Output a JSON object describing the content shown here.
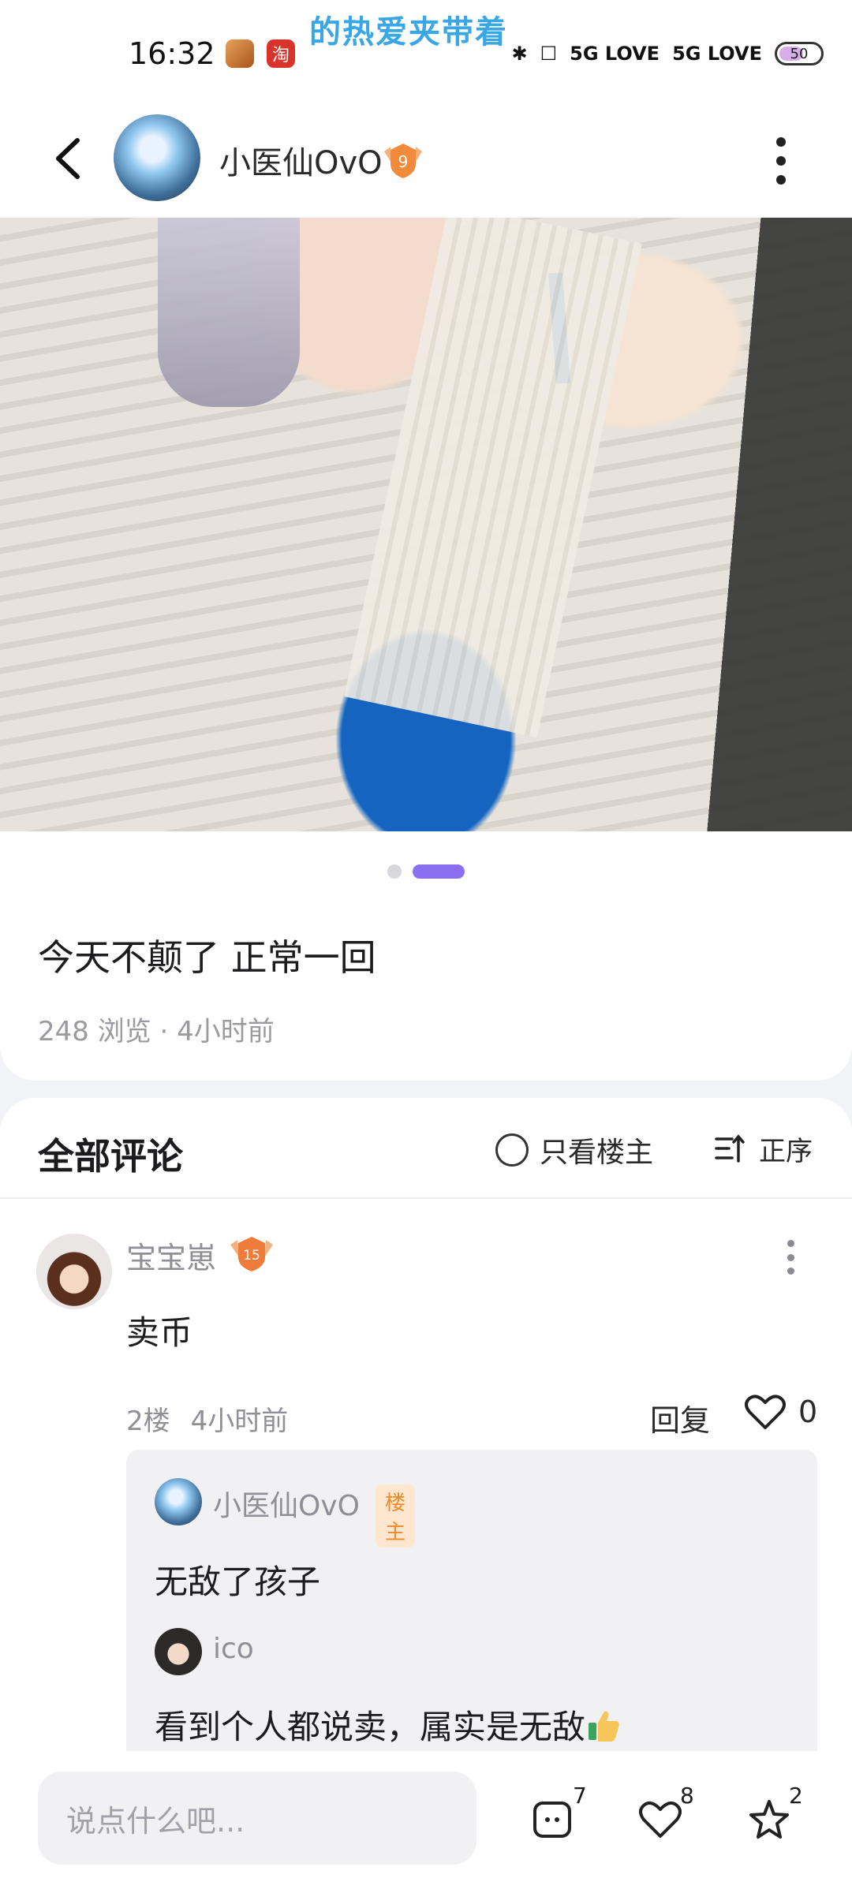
{
  "status_bar": {
    "time": "16:32",
    "marquee_text": "的热爱夹带着",
    "app_icon_taobao": "淘",
    "network_1": "5G LOVE",
    "network_2": "5G LOVE",
    "battery": "50"
  },
  "header": {
    "username": "小医仙OvO",
    "level": "9"
  },
  "post": {
    "image_count": 2,
    "active_image_index": 2,
    "title": "今天不颠了 正常一回",
    "meta": "248 浏览 · 4小时前"
  },
  "comments": {
    "title": "全部评论",
    "only_op_label": "只看楼主",
    "sort_label": "正序",
    "items": [
      {
        "author": "宝宝崽",
        "level": "15",
        "text": "卖币",
        "floor": "2楼",
        "time": "4小时前",
        "reply_label": "回复",
        "likes": "0",
        "replies": [
          {
            "author": "小医仙OvO",
            "tag": "楼主",
            "text": "无敌了孩子"
          },
          {
            "author": "ico",
            "text": "看到个人都说卖，属实是无敌"
          }
        ]
      }
    ]
  },
  "bottom_bar": {
    "input_placeholder": "说点什么吧...",
    "comment_count": "7",
    "like_count": "8",
    "favorite_count": "2"
  },
  "colors": {
    "accent": "#8b6ff1",
    "op_tag_bg": "#ffe7cf",
    "op_tag_text": "#f08a28",
    "muted_text": "#8f8f96"
  }
}
